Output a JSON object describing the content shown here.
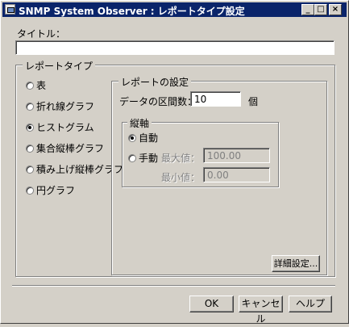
{
  "window": {
    "title": "SNMP System Observer : レポートタイプ設定",
    "minimize": "_",
    "maximize": "□",
    "close": "×"
  },
  "title_field": {
    "label": "タイトル：",
    "value": ""
  },
  "report_type": {
    "legend": "レポートタイプ",
    "options": [
      "表",
      "折れ線グラフ",
      "ヒストグラム",
      "集合縦棒グラフ",
      "積み上げ縦棒グラフ",
      "円グラフ"
    ],
    "selected": "ヒストグラム"
  },
  "report_settings": {
    "legend": "レポートの設定",
    "interval_label": "データの区間数：",
    "interval_value": "10",
    "interval_unit": "個",
    "vertical_axis": {
      "legend": "縦軸",
      "auto_label": "自動",
      "manual_label": "手動",
      "selected": "自動",
      "max_label": "最大値：",
      "max_value": "100.00",
      "min_label": "最小値：",
      "min_value": "0.00"
    },
    "detail_button": "詳細設定..."
  },
  "footer": {
    "ok": "OK",
    "cancel": "キャンセル",
    "help": "ヘルプ"
  }
}
